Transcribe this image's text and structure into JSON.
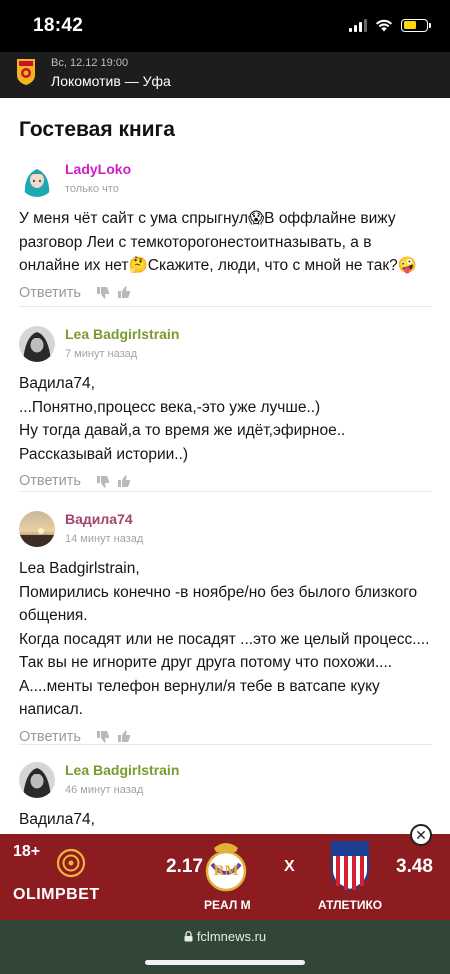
{
  "status_bar": {
    "time": "18:42"
  },
  "match": {
    "date": "Вс, 12.12 19:00",
    "title": "Локомотив — Уфа"
  },
  "page": {
    "title": "Гостевая книга"
  },
  "reply_label": "Ответить",
  "comments": [
    {
      "author": "LadyLoko",
      "author_color": "#d11cc5",
      "time": "только что",
      "text": "У меня чёт сайт с ума спрыгнул😱В оффлайне вижу разговор Леи с темкоторогонестоитназывать, а в онлайне их нет🤔Скажите, люди, что с мной не так?🤪"
    },
    {
      "author": "Lea Badgirlstrain",
      "author_color": "#7c9a2f",
      "time": "7 минут назад",
      "text": "Вадила74,\n...Понятно,процесс века,-это уже лучше..)\nНу тогда давай,а то время же идёт,эфирное.. Рассказывай истории..)"
    },
    {
      "author": "Вадила74",
      "author_color": "#a4436b",
      "time": "14 минут назад",
      "text": "Lea Badgirlstrain,\nПомирились конечно -в ноябре/но без былого близкого общения.\nКогда посадят или не посадят ...это же целый процесс....\nТак вы не игнорите друг друга потому что похожи....\nА....менты телефон вернули/я тебе в ватсапе куку написал."
    },
    {
      "author": "Lea Badgirlstrain",
      "author_color": "#7c9a2f",
      "time": "46 минут назад",
      "text": "Вадила74,"
    }
  ],
  "ad": {
    "age": "18+",
    "brand": "OLIMPBET",
    "odds_home": "2.17",
    "vs": "X",
    "odds_away": "3.48",
    "team_home": "РЕАЛ М",
    "team_away": "АТЛЕТИКО",
    "close": "✕",
    "background_color": "#8c1c1f"
  },
  "browser": {
    "url": "fclmnews.ru",
    "lock": "🔒"
  },
  "icons": [
    "signal-icon",
    "wifi-icon",
    "battery-icon",
    "club-logo",
    "dislike-icon",
    "like-icon",
    "close-icon",
    "lock-icon"
  ]
}
